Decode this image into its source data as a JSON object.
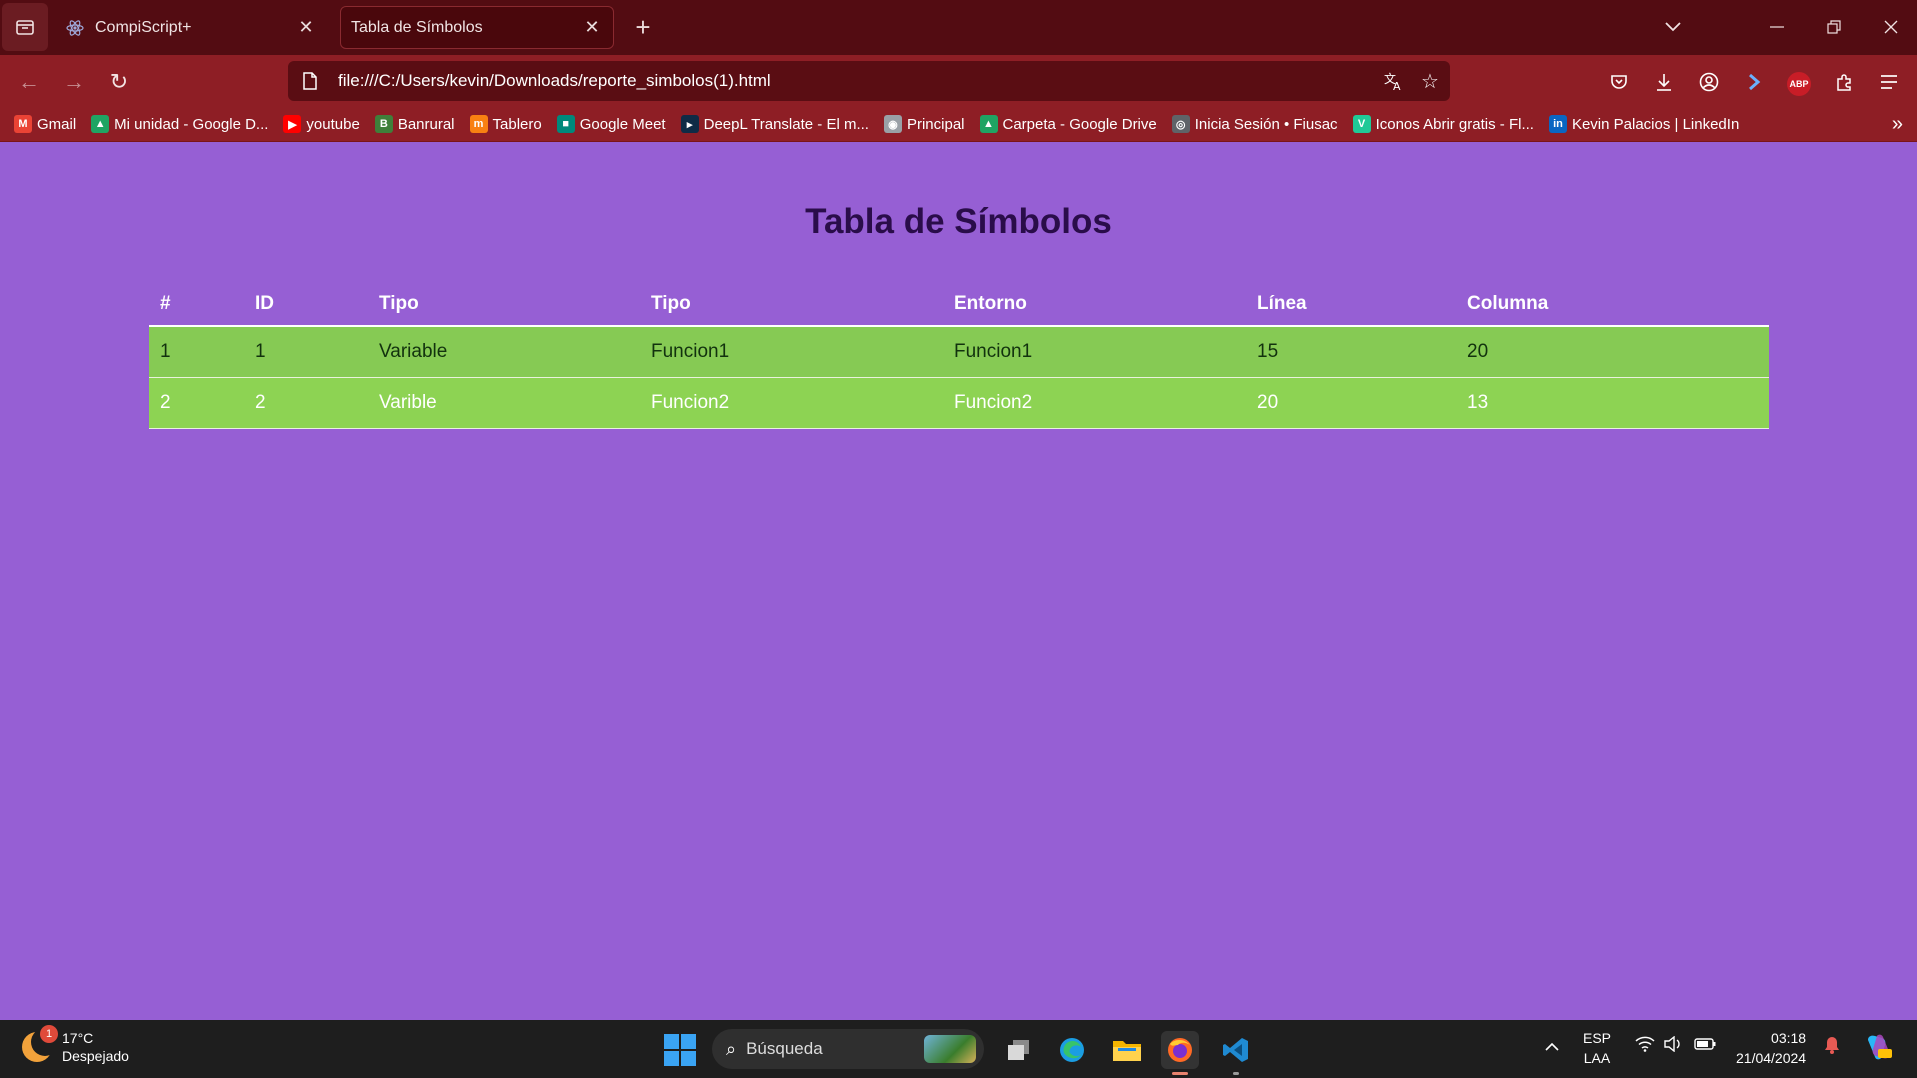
{
  "browser": {
    "tabs": [
      {
        "title": "CompiScript+",
        "icon": "react-icon"
      },
      {
        "title": "Tabla de Símbolos",
        "icon": "none"
      }
    ],
    "url": "file:///C:/Users/kevin/Downloads/reporte_simbolos(1).html",
    "bookmarks": [
      {
        "label": "Gmail",
        "icon": "gmail-icon",
        "color": "#ea4335",
        "glyph": "M"
      },
      {
        "label": "Mi unidad - Google D...",
        "icon": "google-drive-icon",
        "color": "#1fa463",
        "glyph": "▲"
      },
      {
        "label": "youtube",
        "icon": "youtube-icon",
        "color": "#ff0000",
        "glyph": "▶"
      },
      {
        "label": "Banrural",
        "icon": "banrural-icon",
        "color": "#3f7f3a",
        "glyph": "B"
      },
      {
        "label": "Tablero",
        "icon": "moodle-icon",
        "color": "#f98012",
        "glyph": "m"
      },
      {
        "label": "Google Meet",
        "icon": "google-meet-icon",
        "color": "#00897b",
        "glyph": "■"
      },
      {
        "label": "DeepL Translate - El m...",
        "icon": "deepl-icon",
        "color": "#0f2b46",
        "glyph": "▸"
      },
      {
        "label": "Principal",
        "icon": "principal-icon",
        "color": "#9aa0a6",
        "glyph": "◉"
      },
      {
        "label": "Carpeta - Google Drive",
        "icon": "google-drive-icon",
        "color": "#1fa463",
        "glyph": "▲"
      },
      {
        "label": "Inicia Sesión • Fiusac",
        "icon": "fiusac-icon",
        "color": "#5f6368",
        "glyph": "◎"
      },
      {
        "label": "Iconos Abrir gratis - Fl...",
        "icon": "flaticon-icon",
        "color": "#20c997",
        "glyph": "V"
      },
      {
        "label": "Kevin Palacios | LinkedIn",
        "icon": "linkedin-icon",
        "color": "#0a66c2",
        "glyph": "in"
      }
    ]
  },
  "page": {
    "title": "Tabla de Símbolos",
    "table": {
      "headers": [
        "#",
        "ID",
        "Tipo",
        "Tipo",
        "Entorno",
        "Línea",
        "Columna"
      ],
      "rows": [
        [
          "1",
          "1",
          "Variable",
          "Funcion1",
          "Funcion1",
          "15",
          "20"
        ],
        [
          "2",
          "2",
          "Varible",
          "Funcion2",
          "Funcion2",
          "20",
          "13"
        ]
      ]
    }
  },
  "taskbar": {
    "weather": {
      "temp": "17°C",
      "condition": "Despejado",
      "badge": "1"
    },
    "search_placeholder": "Búsqueda",
    "lang_top": "ESP",
    "lang_bottom": "LAA",
    "time": "03:18",
    "date": "21/04/2024"
  }
}
